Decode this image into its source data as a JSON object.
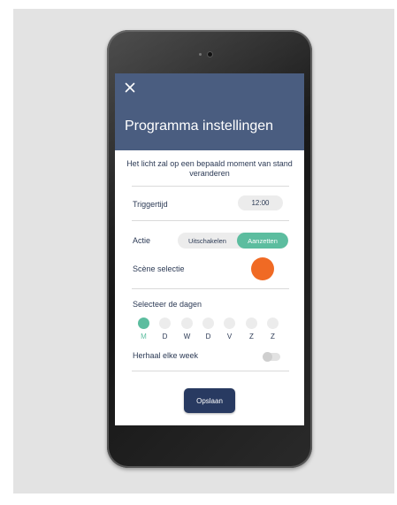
{
  "header": {
    "title": "Programma instellingen",
    "close_icon": "close-icon"
  },
  "description": "Het licht zal op een bepaald moment van stand veranderen",
  "trigger": {
    "label": "Triggertijd",
    "time": "12:00"
  },
  "action": {
    "label": "Actie",
    "options": [
      "Uitschakelen",
      "Aanzetten"
    ],
    "selected": "Aanzetten"
  },
  "scene": {
    "label": "Scène selectie",
    "color": "#f06a24"
  },
  "days": {
    "label": "Selecteer de dagen",
    "items": [
      {
        "letter": "M",
        "selected": true
      },
      {
        "letter": "D",
        "selected": false
      },
      {
        "letter": "W",
        "selected": false
      },
      {
        "letter": "D",
        "selected": false
      },
      {
        "letter": "V",
        "selected": false
      },
      {
        "letter": "Z",
        "selected": false
      },
      {
        "letter": "Z",
        "selected": false
      }
    ]
  },
  "repeat": {
    "label": "Herhaal elke week",
    "enabled": false
  },
  "save_label": "Opslaan",
  "colors": {
    "header": "#4a5d80",
    "accent": "#5cbd9f",
    "button": "#283a61",
    "text": "#2c3a55"
  }
}
